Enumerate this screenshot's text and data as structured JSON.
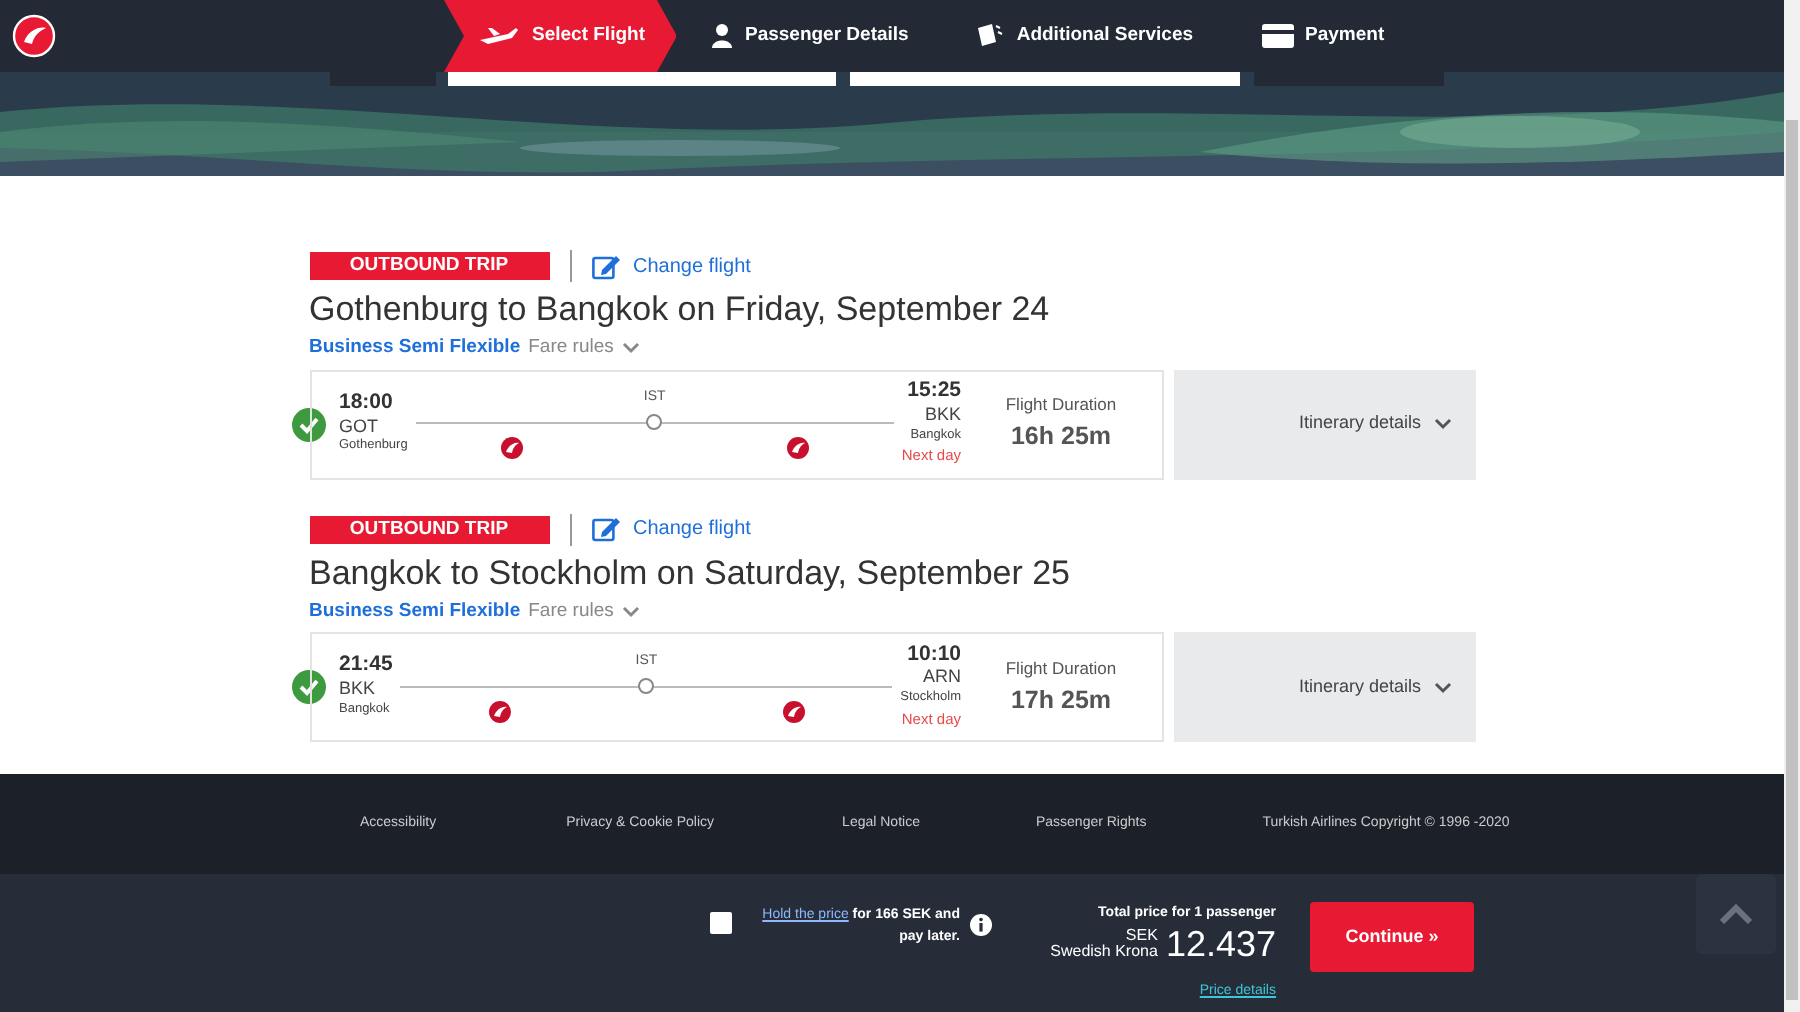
{
  "steps": [
    {
      "kind": "plane",
      "label": "Select Flight",
      "selected": true
    },
    {
      "kind": "person",
      "label": "Passenger Details",
      "selected": false
    },
    {
      "kind": "tickets",
      "label": "Additional Services",
      "selected": false
    },
    {
      "kind": "card",
      "label": "Payment",
      "selected": false
    }
  ],
  "flights": [
    {
      "trip_label": "OUTBOUND TRIP",
      "change_flight": "Change flight",
      "title": "Gothenburg to Bangkok on Friday, September 24",
      "fare_class": "Business Semi Flexible",
      "fare_rules": "Fare rules",
      "selected": true,
      "departure": {
        "time": "18:00",
        "code": "GOT",
        "city": "Gothenburg"
      },
      "stop": "IST",
      "arrival": {
        "time": "15:25",
        "code": "BKK",
        "city": "Bangkok",
        "note": "Next day"
      },
      "duration_label": "Flight Duration",
      "duration": "16h 25m",
      "details": "Itinerary details"
    },
    {
      "trip_label": "OUTBOUND TRIP",
      "change_flight": "Change flight",
      "title": "Bangkok to Stockholm on Saturday, September 25",
      "fare_class": "Business Semi Flexible",
      "fare_rules": "Fare rules",
      "selected": true,
      "departure": {
        "time": "21:45",
        "code": "BKK",
        "city": "Bangkok"
      },
      "stop": "IST",
      "arrival": {
        "time": "10:10",
        "code": "ARN",
        "city": "Stockholm",
        "note": "Next day"
      },
      "duration_label": "Flight Duration",
      "duration": "17h 25m",
      "details": "Itinerary details"
    }
  ],
  "footer_links": [
    "Accessibility",
    "Privacy & Cookie Policy",
    "Legal Notice",
    "Passenger Rights",
    "Turkish Airlines Copyright © 1996 -2020"
  ],
  "hold": {
    "checked": false,
    "link": "Hold the price",
    "text": "for 166 SEK and pay later."
  },
  "total": {
    "label": "Total price for 1 passenger",
    "currency": "SEK",
    "currency_name": "Swedish Krona",
    "amount": "12.437",
    "details": "Price details"
  },
  "continue": "Continue »"
}
